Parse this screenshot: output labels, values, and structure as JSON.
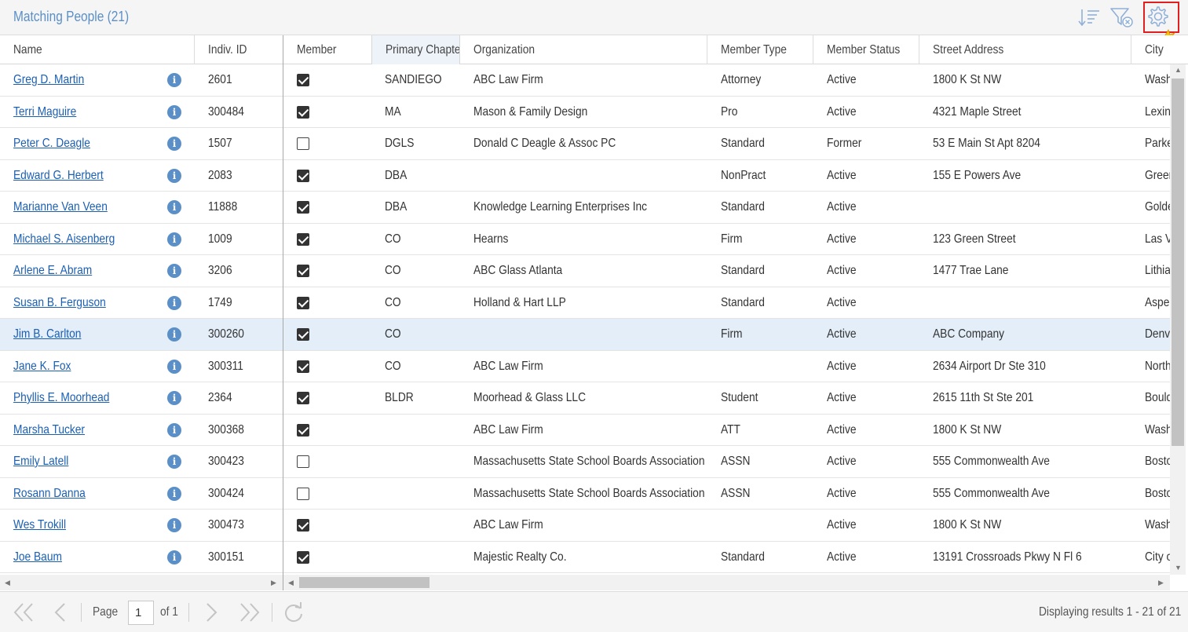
{
  "header": {
    "title": "Matching People (21)",
    "icons": [
      "sort-icon",
      "filter-clear-icon",
      "settings-gear-icon"
    ]
  },
  "columns": {
    "name": "Name",
    "indiv_id": "Indiv. ID",
    "member": "Member",
    "primary_chapter": "Primary Chapter",
    "organization": "Organization",
    "member_type": "Member Type",
    "member_status": "Member Status",
    "street_address": "Street Address",
    "city": "City"
  },
  "rows": [
    {
      "name": "Greg D. Martin",
      "id": "2601",
      "member": true,
      "chapter": "SANDIEGO",
      "org": "ABC Law Firm",
      "type": "Attorney",
      "status": "Active",
      "address": "1800 K St NW",
      "city": "Wash"
    },
    {
      "name": "Terri Maguire",
      "id": "300484",
      "member": true,
      "chapter": "MA",
      "org": "Mason & Family Design",
      "type": "Pro",
      "status": "Active",
      "address": "4321 Maple Street",
      "city": "Lexin"
    },
    {
      "name": "Peter C. Deagle",
      "id": "1507",
      "member": false,
      "chapter": "DGLS",
      "org": "Donald C Deagle & Assoc PC",
      "type": "Standard",
      "status": "Former",
      "address": "53 E Main St Apt 8204",
      "city": "Parke"
    },
    {
      "name": "Edward G. Herbert",
      "id": "2083",
      "member": true,
      "chapter": "DBA",
      "org": "",
      "type": "NonPract",
      "status": "Active",
      "address": "155 E Powers Ave",
      "city": "Greer"
    },
    {
      "name": "Marianne Van Veen",
      "id": "11888",
      "member": true,
      "chapter": "DBA",
      "org": "Knowledge Learning Enterprises Inc",
      "type": "Standard",
      "status": "Active",
      "address": "",
      "city": "Golde"
    },
    {
      "name": "Michael S. Aisenberg",
      "id": "1009",
      "member": true,
      "chapter": "CO",
      "org": "Hearns",
      "type": "Firm",
      "status": "Active",
      "address": "123 Green Street",
      "city": "Las Ve"
    },
    {
      "name": "Arlene E. Abram",
      "id": "3206",
      "member": true,
      "chapter": "CO",
      "org": "ABC Glass Atlanta",
      "type": "Standard",
      "status": "Active",
      "address": "1477 Trae Lane",
      "city": "Lithia"
    },
    {
      "name": "Susan B. Ferguson",
      "id": "1749",
      "member": true,
      "chapter": "CO",
      "org": "Holland & Hart LLP",
      "type": "Standard",
      "status": "Active",
      "address": "",
      "city": "Asper"
    },
    {
      "name": "Jim B. Carlton",
      "id": "300260",
      "member": true,
      "chapter": "CO",
      "org": "",
      "type": "Firm",
      "status": "Active",
      "address": "ABC Company",
      "city": "Denve",
      "selected": true
    },
    {
      "name": "Jane K. Fox",
      "id": "300311",
      "member": true,
      "chapter": "CO",
      "org": "ABC Law Firm",
      "type": "",
      "status": "Active",
      "address": "2634 Airport Dr Ste 310",
      "city": "North"
    },
    {
      "name": "Phyllis E. Moorhead",
      "id": "2364",
      "member": true,
      "chapter": "BLDR",
      "org": "Moorhead & Glass LLC",
      "type": "Student",
      "status": "Active",
      "address": "2615 11th St Ste 201",
      "city": "Bould"
    },
    {
      "name": "Marsha Tucker",
      "id": "300368",
      "member": true,
      "chapter": "",
      "org": "ABC Law Firm",
      "type": "ATT",
      "status": "Active",
      "address": "1800 K St NW",
      "city": "Wash"
    },
    {
      "name": "Emily Latell",
      "id": "300423",
      "member": false,
      "chapter": "",
      "org": "Massachusetts State School Boards Association",
      "type": "ASSN",
      "status": "Active",
      "address": "555 Commonwealth Ave",
      "city": "Bosto"
    },
    {
      "name": "Rosann Danna",
      "id": "300424",
      "member": false,
      "chapter": "",
      "org": "Massachusetts State School Boards Association",
      "type": "ASSN",
      "status": "Active",
      "address": "555 Commonwealth Ave",
      "city": "Bosto"
    },
    {
      "name": "Wes Trokill",
      "id": "300473",
      "member": true,
      "chapter": "",
      "org": "ABC Law Firm",
      "type": "",
      "status": "Active",
      "address": "1800 K St NW",
      "city": "Wash"
    },
    {
      "name": "Joe Baum",
      "id": "300151",
      "member": true,
      "chapter": "",
      "org": "Majestic Realty Co.",
      "type": "Standard",
      "status": "Active",
      "address": "13191 Crossroads Pkwy N Fl 6",
      "city": "City o"
    }
  ],
  "pager": {
    "page_label": "Page",
    "page_value": "1",
    "of_label": "of 1",
    "results": "Displaying results 1 - 21 of 21"
  },
  "colors": {
    "accent": "#5a8fc8",
    "link": "#1a5fb4",
    "selected_row": "#e4eef8",
    "highlight_box": "#e02020"
  }
}
